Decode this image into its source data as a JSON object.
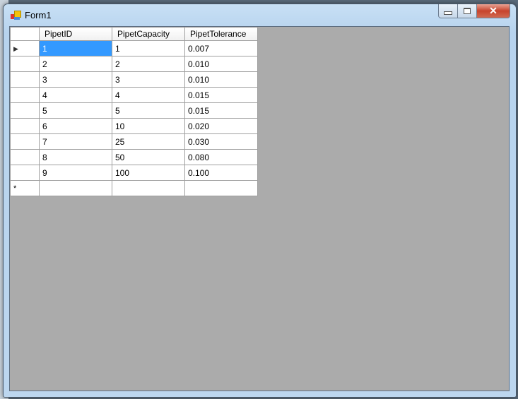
{
  "window": {
    "title": "Form1",
    "minimize": "minimize",
    "maximize": "maximize",
    "close": "close"
  },
  "grid": {
    "columns": [
      "PipetID",
      "PipetCapacity",
      "PipetTolerance"
    ],
    "rows": [
      [
        "1",
        "1",
        "0.007"
      ],
      [
        "2",
        "2",
        "0.010"
      ],
      [
        "3",
        "3",
        "0.010"
      ],
      [
        "4",
        "4",
        "0.015"
      ],
      [
        "5",
        "5",
        "0.015"
      ],
      [
        "6",
        "10",
        "0.020"
      ],
      [
        "7",
        "25",
        "0.030"
      ],
      [
        "8",
        "50",
        "0.080"
      ],
      [
        "9",
        "100",
        "0.100"
      ]
    ],
    "current_row_marker": "▶",
    "new_row_marker": "*",
    "selected_cell": {
      "row": 0,
      "column": 0
    },
    "selection_color": "#3399ff"
  }
}
